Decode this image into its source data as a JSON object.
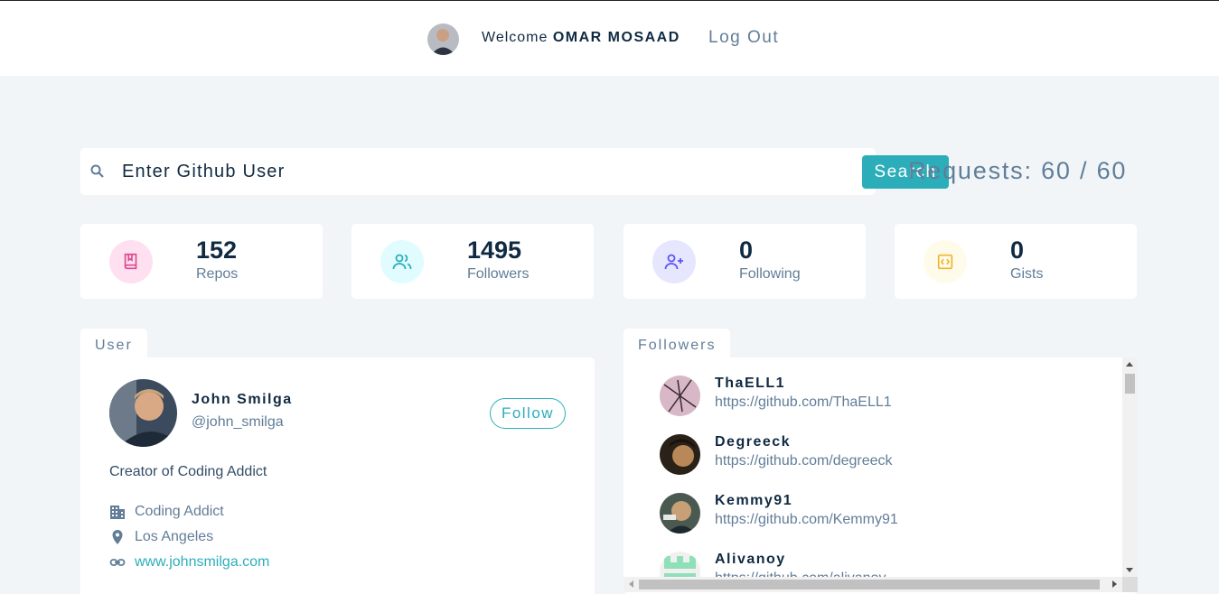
{
  "header": {
    "welcome_prefix": "Welcome",
    "user_name": "OMAR MOSAAD",
    "logout_label": "Log Out"
  },
  "search": {
    "placeholder": "Enter Github User",
    "button_label": "Search",
    "requests_text": "Requests: 60 / 60"
  },
  "stats": [
    {
      "value": "152",
      "label": "Repos",
      "icon": "book-icon",
      "color": "#da4a91",
      "bg": "#ffe0f0"
    },
    {
      "value": "1495",
      "label": "Followers",
      "icon": "users-icon",
      "color": "#2caeba",
      "bg": "#e0fcff"
    },
    {
      "value": "0",
      "label": "Following",
      "icon": "user-plus-icon",
      "color": "#5d55fa",
      "bg": "#e6e6ff"
    },
    {
      "value": "0",
      "label": "Gists",
      "icon": "code-icon",
      "color": "#f0b429",
      "bg": "#fffbea"
    }
  ],
  "user_card": {
    "tab_label": "User",
    "name": "John Smilga",
    "handle": "@john_smilga",
    "follow_label": "Follow",
    "bio": "Creator of Coding Addict",
    "company": "Coding Addict",
    "location": "Los Angeles",
    "blog": "www.johnsmilga.com"
  },
  "followers_card": {
    "tab_label": "Followers",
    "items": [
      {
        "login": "ThaELL1",
        "url": "https://github.com/ThaELL1"
      },
      {
        "login": "Degreeck",
        "url": "https://github.com/degreeck"
      },
      {
        "login": "Kemmy91",
        "url": "https://github.com/Kemmy91"
      },
      {
        "login": "Alivanoy",
        "url": "https://github.com/alivanoy"
      }
    ]
  }
}
